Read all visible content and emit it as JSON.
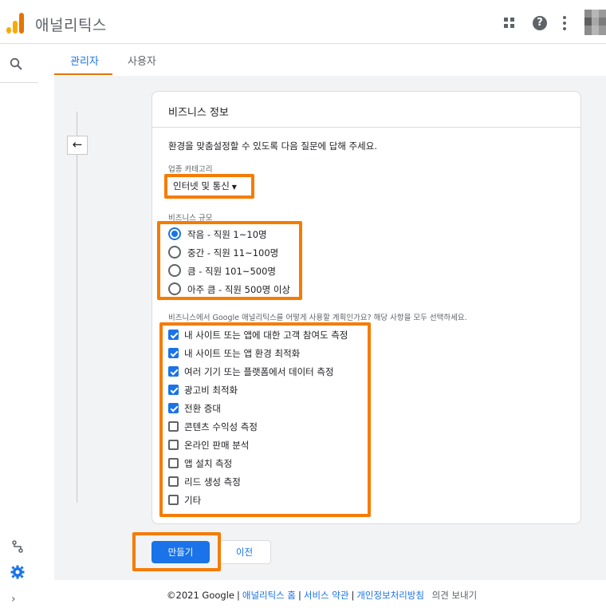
{
  "header": {
    "app_title": "애널리틱스",
    "icons": [
      "apps-icon",
      "help-icon",
      "more-vert-icon",
      "avatar"
    ]
  },
  "rail": {
    "icons": [
      "search-icon",
      "route-icon",
      "gear-icon",
      "chevron-right-icon"
    ]
  },
  "tabs": [
    {
      "label": "관리자",
      "active": true
    },
    {
      "label": "사용자",
      "active": false
    }
  ],
  "card": {
    "title": "비즈니스 정보",
    "intro": "환경을 맞춤설정할 수 있도록 다음 질문에 답해 주세요.",
    "category_label": "업종 카테고리",
    "category_value": "인터넷 및 통신",
    "size_label": "비즈니스 규모",
    "size_options": [
      {
        "label": "작음 - 직원 1~10명",
        "selected": true
      },
      {
        "label": "중간 - 직원 11~100명",
        "selected": false
      },
      {
        "label": "큼 - 직원 101~500명",
        "selected": false
      },
      {
        "label": "아주 큼 - 직원 500명 이상",
        "selected": false
      }
    ],
    "usage_label": "비즈니스에서 Google 애널리틱스를 어떻게 사용할 계획인가요? 해당 사항을 모두 선택하세요.",
    "usage_options": [
      {
        "label": "내 사이트 또는 앱에 대한 고객 참여도 측정",
        "checked": true
      },
      {
        "label": "내 사이트 또는 앱 환경 최적화",
        "checked": true
      },
      {
        "label": "여러 기기 또는 플랫폼에서 데이터 측정",
        "checked": true
      },
      {
        "label": "광고비 최적화",
        "checked": true
      },
      {
        "label": "전환 증대",
        "checked": true
      },
      {
        "label": "콘텐츠 수익성 측정",
        "checked": false
      },
      {
        "label": "온라인 판매 분석",
        "checked": false
      },
      {
        "label": "앱 설치 측정",
        "checked": false
      },
      {
        "label": "리드 생성 측정",
        "checked": false
      },
      {
        "label": "기타",
        "checked": false
      }
    ]
  },
  "buttons": {
    "create": "만들기",
    "prev": "이전"
  },
  "footer": {
    "copyright": "©2021 Google",
    "home": "애널리틱스 홈",
    "terms": "서비스 약관",
    "privacy": "개인정보처리방침",
    "feedback": "의견 보내기"
  },
  "colors": {
    "accent": "#1a73e8",
    "highlight": "#f57c00",
    "tab_underline": "#e37400"
  }
}
